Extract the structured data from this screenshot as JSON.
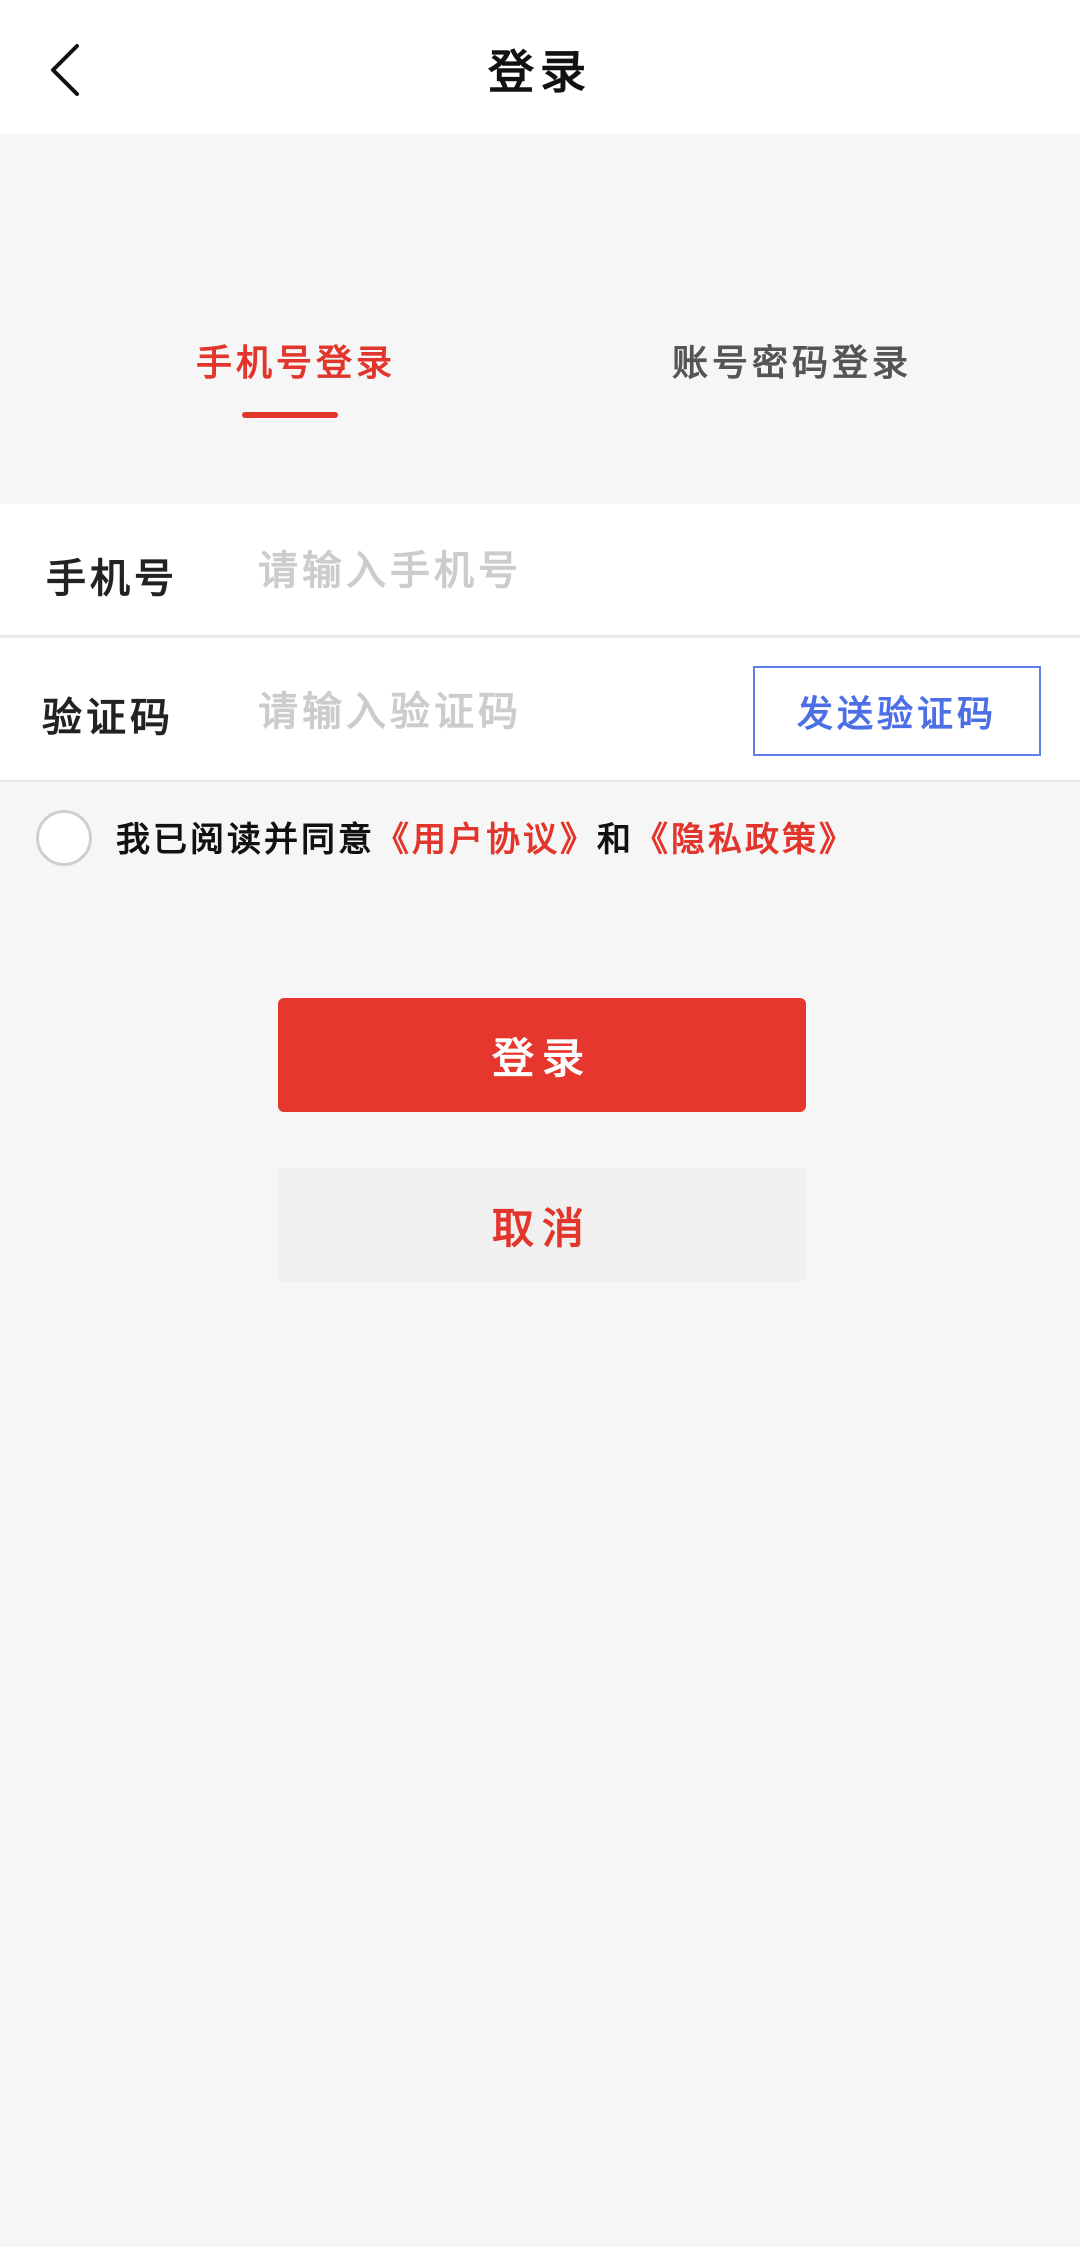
{
  "header": {
    "title": "登录",
    "back_icon": "chevron-left-icon"
  },
  "tabs": [
    {
      "label": "手机号登录",
      "active": true
    },
    {
      "label": "账号密码登录",
      "active": false
    }
  ],
  "form": {
    "phone": {
      "label": "手机号",
      "value": "",
      "placeholder": "请输入手机号"
    },
    "code": {
      "label": "验证码",
      "value": "",
      "placeholder": "请输入验证码",
      "send_label": "发送验证码"
    }
  },
  "agreement": {
    "checked": false,
    "prefix": "我已阅读并同意",
    "user_agreement": "《用户协议》",
    "conjunction": "和",
    "privacy_policy": "《隐私政策》"
  },
  "actions": {
    "login_label": "登录",
    "cancel_label": "取消"
  },
  "colors": {
    "accent": "#e5372d",
    "link_blue": "#4c6fe6",
    "background": "#f6f6f6"
  }
}
